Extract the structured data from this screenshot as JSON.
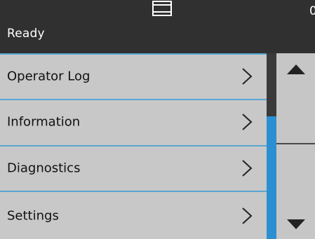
{
  "header": {
    "status": "Ready",
    "counter": "0",
    "document_icon": "document-feed-icon"
  },
  "menu": {
    "items": [
      {
        "label": "Operator Log",
        "icon": "chevron-right-icon"
      },
      {
        "label": "Information",
        "icon": "chevron-right-icon"
      },
      {
        "label": "Diagnostics",
        "icon": "chevron-right-icon"
      },
      {
        "label": "Settings",
        "icon": "chevron-right-icon"
      }
    ]
  },
  "scroll": {
    "up_icon": "triangle-up-icon",
    "down_icon": "triangle-down-icon"
  },
  "colors": {
    "background": "#2b2b2b",
    "menu_bg": "#c8c8c8",
    "separator": "#5aa6d2",
    "scroll_thumb": "#2c8fd1"
  }
}
